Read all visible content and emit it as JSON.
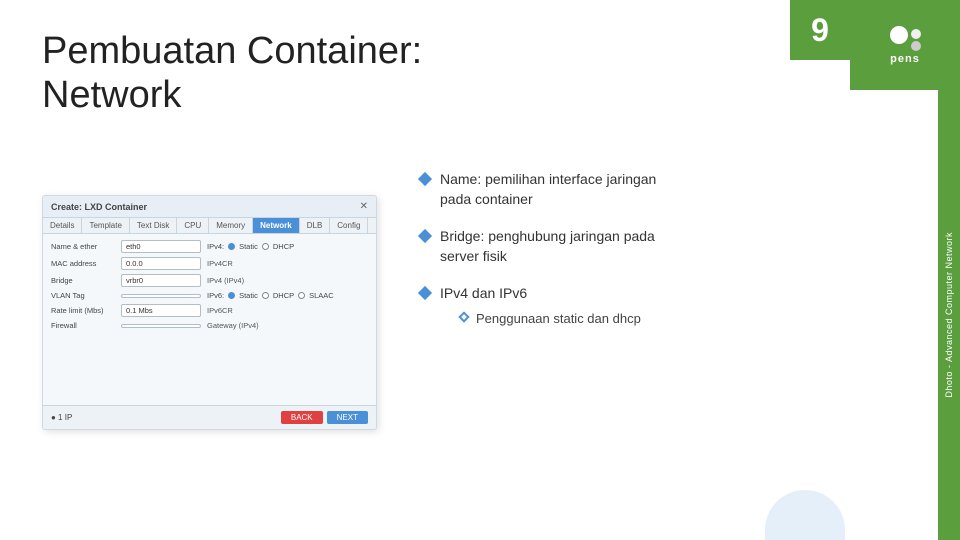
{
  "title": {
    "line1": "Pembuatan Container:",
    "line2": "Network"
  },
  "slide_number": "9",
  "vertical_label": "Dhoto - Advanced Computer Network",
  "bullets": [
    {
      "id": "bullet1",
      "text": "Name: pemilihan interface jaringan\npada container"
    },
    {
      "id": "bullet2",
      "text": "Bridge: penghubung jaringan pada\nserver fisik"
    },
    {
      "id": "bullet3",
      "text": "IPv4 dan IPv6",
      "sub": [
        {
          "id": "sub1",
          "text": "Penggunaan static dan dhcp"
        }
      ]
    }
  ],
  "panel": {
    "header_title": "Create: LXD Container",
    "tabs": [
      "Details",
      "Template",
      "Text Disk",
      "CPU",
      "Memory",
      "Network",
      "DLB",
      "Config"
    ],
    "active_tab": "Network",
    "form_rows": [
      {
        "label": "Name & ether",
        "value": "eth0",
        "extra": "IPv4: ● Static ○ DHCP"
      },
      {
        "label": "MAC address",
        "value": "0.0.0",
        "extra": "IPv4CR"
      },
      {
        "label": "Bridge",
        "value": "vrbr0",
        "extra": "IPv4 (IPv4)"
      },
      {
        "label": "VLAN Tag",
        "value": "",
        "extra": "IPv6: ● Static ○ DHCP ○ SLAAC"
      },
      {
        "label": "Rate limit (Mbs)",
        "value": "0.1 Mbs",
        "extra": "IPv6CR"
      },
      {
        "label": "Firewall",
        "value": "",
        "extra": "Gateway (IPv4)"
      }
    ],
    "footer_left": "● 1 IP",
    "btn_cancel": "BACK",
    "btn_ok": "NEXT"
  },
  "colors": {
    "accent_green": "#5a9e3e",
    "accent_blue": "#4a90d9"
  }
}
